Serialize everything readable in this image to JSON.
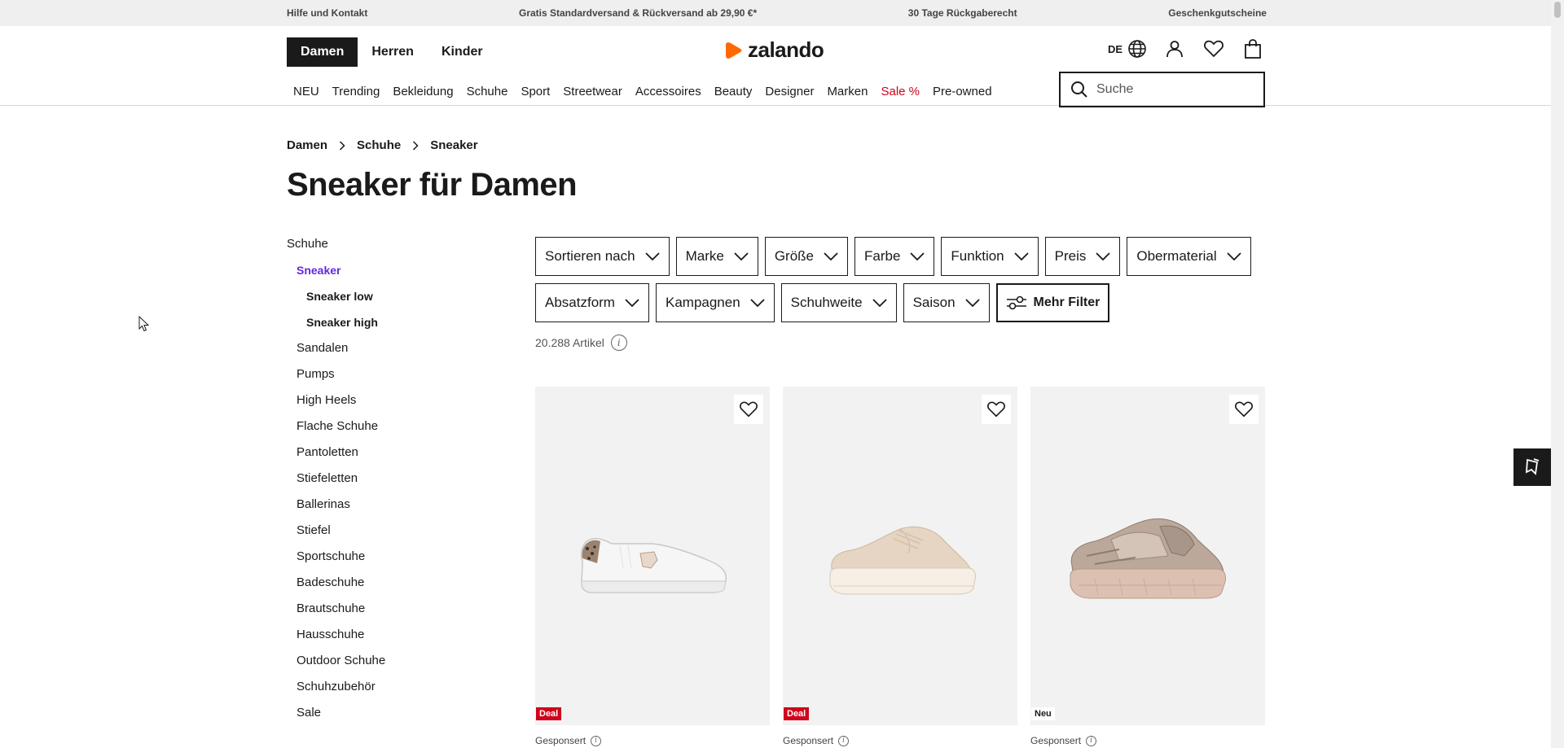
{
  "topbar": {
    "help": "Hilfe und Kontakt",
    "shipping": "Gratis Standardversand & Rückversand ab 29,90 €*",
    "returns": "30 Tage Rückgaberecht",
    "vouchers": "Geschenkgutscheine"
  },
  "header": {
    "tabs": [
      "Damen",
      "Herren",
      "Kinder"
    ],
    "logo_text": "zalando",
    "language": "DE",
    "nav": [
      "NEU",
      "Trending",
      "Bekleidung",
      "Schuhe",
      "Sport",
      "Streetwear",
      "Accessoires",
      "Beauty",
      "Designer",
      "Marken",
      "Sale %",
      "Pre-owned"
    ],
    "search_placeholder": "Suche"
  },
  "breadcrumb": [
    "Damen",
    "Schuhe",
    "Sneaker"
  ],
  "page_title": "Sneaker für Damen",
  "sidebar": {
    "root": "Schuhe",
    "active": "Sneaker",
    "sub": [
      "Sneaker low",
      "Sneaker high"
    ],
    "items": [
      "Sandalen",
      "Pumps",
      "High Heels",
      "Flache Schuhe",
      "Pantoletten",
      "Stiefeletten",
      "Ballerinas",
      "Stiefel",
      "Sportschuhe",
      "Badeschuhe",
      "Brautschuhe",
      "Hausschuhe",
      "Outdoor Schuhe",
      "Schuhzubehör",
      "Sale"
    ]
  },
  "filters": {
    "row1": [
      "Sortieren nach",
      "Marke",
      "Größe",
      "Farbe",
      "Funktion",
      "Preis",
      "Obermaterial"
    ],
    "row2": [
      "Absatzform",
      "Kampagnen",
      "Schuhweite",
      "Saison"
    ],
    "more": "Mehr Filter"
  },
  "article_count": "20.288 Artikel",
  "products": [
    {
      "badge": "Deal",
      "sponsored": "Gesponsert"
    },
    {
      "badge": "Deal",
      "sponsored": "Gesponsert"
    },
    {
      "badge": "Neu",
      "sponsored": "Gesponsert"
    }
  ],
  "colors": {
    "brand_orange": "#ff6900",
    "sale_red": "#d0021b",
    "active_purple": "#6328e0"
  },
  "icons": [
    "globe-icon",
    "user-icon",
    "heart-icon",
    "bag-icon",
    "search-icon",
    "chevron-right-icon",
    "chevron-down-icon",
    "filter-sliders-icon",
    "info-icon",
    "bookmark-icon"
  ]
}
